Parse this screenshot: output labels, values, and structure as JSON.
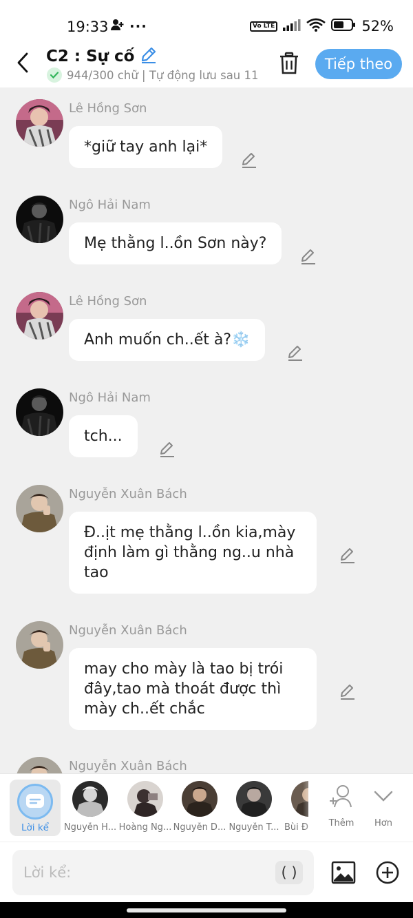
{
  "status_bar": {
    "time": "19:33",
    "volte": "Vo LTE",
    "battery": "52%"
  },
  "header": {
    "title": "C2 : Sự cố",
    "subtitle": "944/300 chữ | Tự động lưu sau 11",
    "next_label": "Tiếp theo"
  },
  "messages": [
    {
      "name": "Lê Hồng Sơn",
      "text": "*giữ tay anh lại*"
    },
    {
      "name": "Ngô Hải Nam",
      "text": "Mẹ thằng l..ồn Sơn này?"
    },
    {
      "name": "Lê Hồng Sơn",
      "text": "Anh muốn ch..ết à?❄️"
    },
    {
      "name": "Ngô Hải Nam",
      "text": "tch..."
    },
    {
      "name": "Nguyễn Xuân Bách",
      "text": "Đ..ịt mẹ thằng l..ồn kia,mày định làm gì thằng ng..u nhà tao"
    },
    {
      "name": "Nguyễn Xuân Bách",
      "text": "may cho mày là tao bị trói đây,tao mà thoát được thì mày ch..ết chắc"
    },
    {
      "name": "Nguyễn Xuân Bách",
      "text": ""
    }
  ],
  "characters": {
    "narrator_label": "Lời kể",
    "items": [
      {
        "label": "Nguyễn H..."
      },
      {
        "label": "Hoàng Ng..."
      },
      {
        "label": "Nguyễn D..."
      },
      {
        "label": "Nguyễn T..."
      },
      {
        "label": "Bùi Đ"
      }
    ],
    "add_label": "Thêm",
    "more_label": "Hơn"
  },
  "composer": {
    "placeholder": "Lời kể:",
    "paren_label": "( )"
  }
}
